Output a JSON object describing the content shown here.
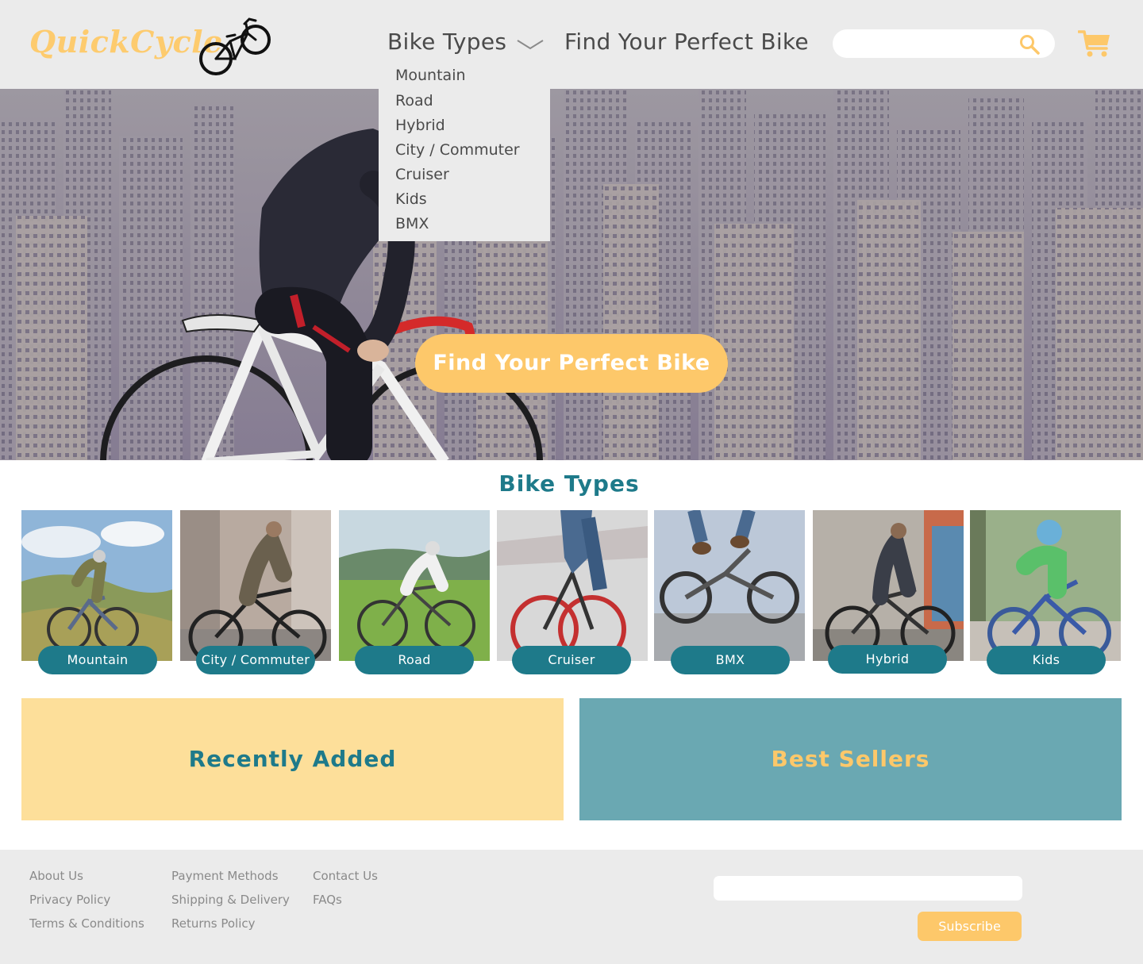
{
  "header": {
    "logo": "QuickCycle",
    "nav_bike_types": "Bike Types",
    "nav_find": "Find Your Perfect Bike",
    "search_placeholder": "",
    "search_value": ""
  },
  "dropdown": {
    "items": [
      "Mountain",
      "Road",
      "Hybrid",
      "City / Commuter",
      "Cruiser",
      "Kids",
      "BMX"
    ]
  },
  "hero": {
    "cta": "Find Your Perfect Bike"
  },
  "bike_types": {
    "title": "Bike Types",
    "tiles": [
      {
        "label": "Mountain"
      },
      {
        "label": "City / Commuter"
      },
      {
        "label": "Road"
      },
      {
        "label": "Cruiser"
      },
      {
        "label": "BMX"
      },
      {
        "label": "Hybrid"
      },
      {
        "label": "Kids"
      }
    ]
  },
  "panels": {
    "recently_added": "Recently Added",
    "best_sellers": "Best Sellers"
  },
  "footer": {
    "col1": [
      "About Us",
      "Privacy Policy",
      "Terms & Conditions"
    ],
    "col2": [
      "Payment Methods",
      "Shipping & Delivery",
      "Returns Policy"
    ],
    "col3": [
      "Contact Us",
      "FAQs"
    ],
    "subscribe_placeholder": "",
    "subscribe_label": "Subscribe"
  },
  "colors": {
    "accent_yellow": "#fdc86a",
    "teal": "#1e7a8a",
    "teal_light": "#6aa8b2",
    "yellow_light": "#fddf9a",
    "header_bg": "#ebebeb"
  },
  "icons": [
    "bicycle-logo-icon",
    "chevron-down-icon",
    "search-icon",
    "cart-icon"
  ]
}
